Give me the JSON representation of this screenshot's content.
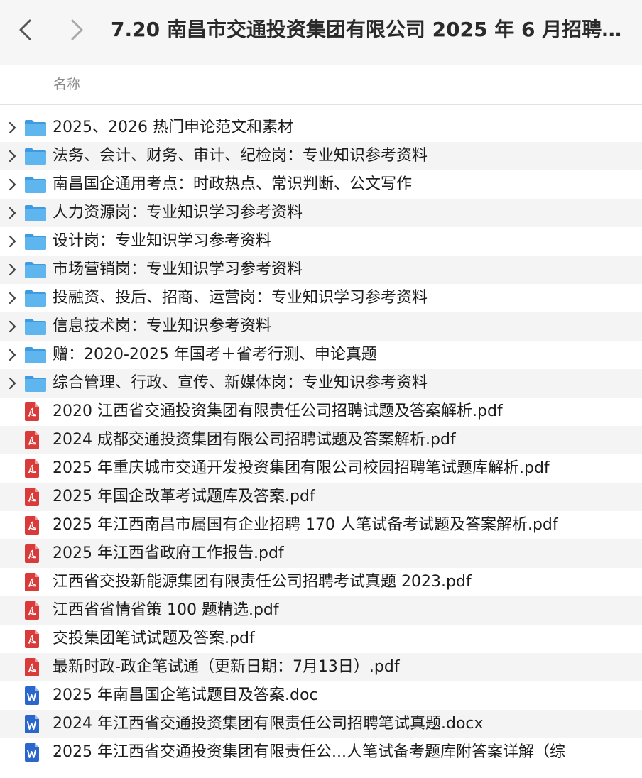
{
  "window": {
    "title": "7.20 南昌市交通投资集团有限公司 2025 年 6 月招聘笔..."
  },
  "toolbar": {
    "back_icon": "chevron-left-icon",
    "forward_icon": "chevron-right-icon"
  },
  "columns": {
    "name": "名称"
  },
  "colors": {
    "folder": "#5fb6ee",
    "pdf": "#d93a3a",
    "word": "#2b66cc",
    "stripe": "#f4f4f4"
  },
  "items": [
    {
      "type": "folder",
      "name": "2025、2026 热门申论范文和素材"
    },
    {
      "type": "folder",
      "name": "法务、会计、财务、审计、纪检岗：专业知识参考资料"
    },
    {
      "type": "folder",
      "name": "南昌国企通用考点：时政热点、常识判断、公文写作"
    },
    {
      "type": "folder",
      "name": "人力资源岗：专业知识学习参考资料"
    },
    {
      "type": "folder",
      "name": "设计岗：专业知识学习参考资料"
    },
    {
      "type": "folder",
      "name": "市场营销岗：专业知识学习参考资料"
    },
    {
      "type": "folder",
      "name": "投融资、投后、招商、运营岗：专业知识学习参考资料"
    },
    {
      "type": "folder",
      "name": "信息技术岗：专业知识参考资料"
    },
    {
      "type": "folder",
      "name": "赠：2020-2025 年国考＋省考行测、申论真题"
    },
    {
      "type": "folder",
      "name": "综合管理、行政、宣传、新媒体岗：专业知识参考资料"
    },
    {
      "type": "pdf",
      "name": "2020 江西省交通投资集团有限责任公司招聘试题及答案解析.pdf"
    },
    {
      "type": "pdf",
      "name": "2024 成都交通投资集团有限公司招聘试题及答案解析.pdf"
    },
    {
      "type": "pdf",
      "name": "2025 年重庆城市交通开发投资集团有限公司校园招聘笔试题库解析.pdf"
    },
    {
      "type": "pdf",
      "name": "2025 年国企改革考试题库及答案.pdf"
    },
    {
      "type": "pdf",
      "name": "2025 年江西南昌市属国有企业招聘 170 人笔试备考试题及答案解析.pdf"
    },
    {
      "type": "pdf",
      "name": "2025 年江西省政府工作报告.pdf"
    },
    {
      "type": "pdf",
      "name": "江西省交投新能源集团有限责任公司招聘考试真题 2023.pdf"
    },
    {
      "type": "pdf",
      "name": "江西省省情省策 100 题精选.pdf"
    },
    {
      "type": "pdf",
      "name": "交投集团笔试试题及答案.pdf"
    },
    {
      "type": "pdf",
      "name": "最新时政-政企笔试通（更新日期：7月13日）.pdf"
    },
    {
      "type": "doc",
      "name": "2025 年南昌国企笔试题目及答案.doc"
    },
    {
      "type": "doc",
      "name": "2024 年江西省交通投资集团有限责任公司招聘笔试真题.docx"
    },
    {
      "type": "doc",
      "name": "2025 年江西省交通投资集团有限责任公...人笔试备考题库附答案详解（综"
    }
  ]
}
